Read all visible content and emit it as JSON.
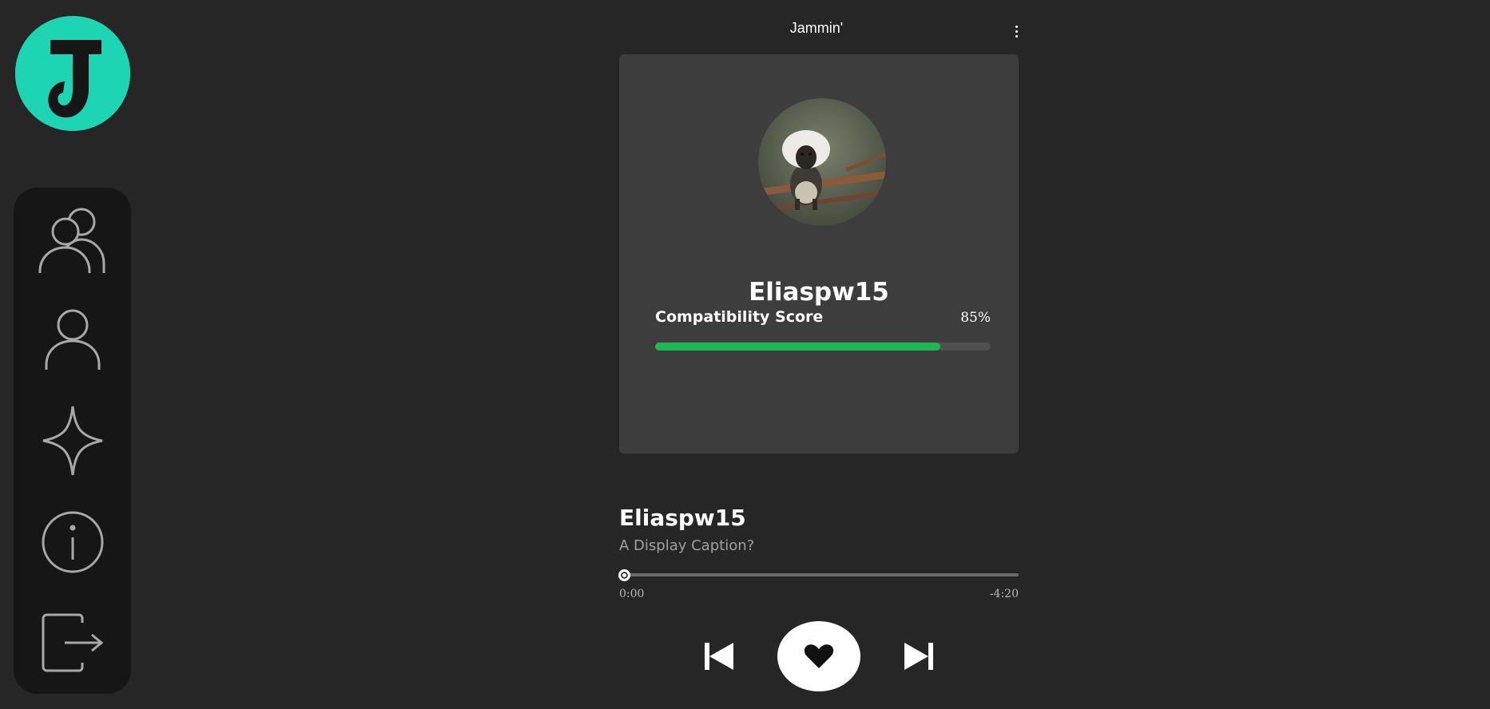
{
  "app": {
    "title": "Jammin'",
    "accent_color": "#1ed5b3",
    "progress_color": "#1db954"
  },
  "logo": {
    "letter": "J",
    "icon": "jammin-logo-icon"
  },
  "nav": {
    "items": [
      {
        "name": "friends",
        "icon": "users-icon"
      },
      {
        "name": "profile",
        "icon": "user-icon"
      },
      {
        "name": "discover",
        "icon": "sparkle-icon"
      },
      {
        "name": "info",
        "icon": "info-icon"
      },
      {
        "name": "logout",
        "icon": "logout-icon"
      }
    ]
  },
  "header": {
    "menu_icon": "more-vertical-icon"
  },
  "card": {
    "username": "Eliaspw15",
    "avatar_icon": "avatar-monkey-photo",
    "compatibility": {
      "label": "Compatibility Score",
      "value_text": "85%",
      "value": 0.85
    }
  },
  "track": {
    "title": "Eliaspw15",
    "caption": "A Display Caption?",
    "elapsed": "0:00",
    "remaining": "-4:20",
    "progress": 0
  },
  "controls": {
    "prev_icon": "skip-back-icon",
    "like_icon": "heart-icon",
    "next_icon": "skip-forward-icon"
  }
}
